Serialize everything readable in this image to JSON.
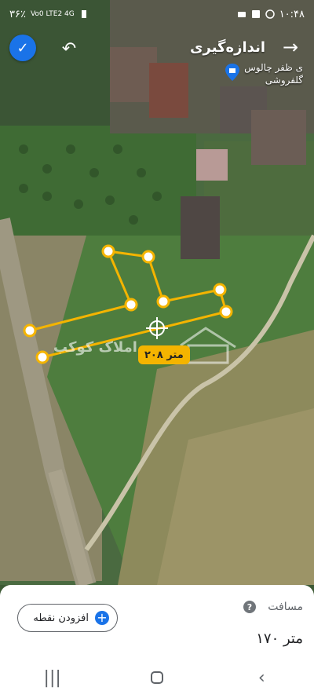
{
  "status_bar": {
    "time": "۱۰:۴۸",
    "battery": "۳۶٪",
    "network": "Vo0 LTE2 4G"
  },
  "toolbar": {
    "title": "اندازه‌گیری",
    "done_icon": "check-icon",
    "undo_icon": "undo-icon",
    "forward_icon": "arrow-right-icon"
  },
  "place": {
    "line1": "ی ظفر چالوس",
    "line2": "گلفروشی"
  },
  "map": {
    "distance_tag": "۲۰۸ متر",
    "watermark": "املاک کوکب",
    "line_color": "#f4b400"
  },
  "sheet": {
    "distance_label": "مسافت",
    "distance_value": "۱۷۰ متر",
    "add_point_label": "افزودن نقطه"
  },
  "navbar": {
    "recent": "recents-icon",
    "home": "home-icon",
    "back": "back-icon"
  }
}
